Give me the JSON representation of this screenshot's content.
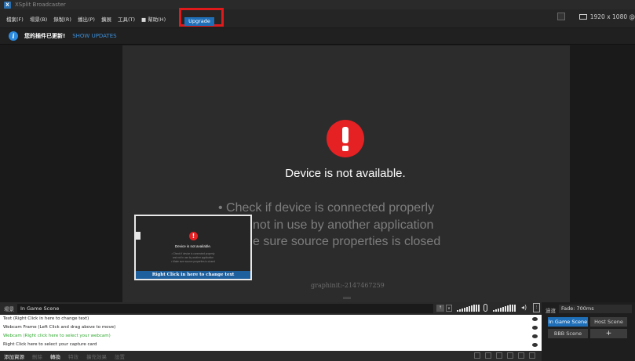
{
  "window": {
    "title": "XSplit Broadcaster",
    "icon": "xsplit-logo-icon"
  },
  "menu": {
    "items": [
      "檔案(F)",
      "場景(B)",
      "錄製(R)",
      "播出(P)",
      "擴展",
      "工具(T)",
      "■ 幫助(H)"
    ],
    "upgrade_label": "Upgrade",
    "resolution": "1920 x 1080 @"
  },
  "notice": {
    "text": "您的插件已更新!",
    "link": "SHOW UPDATES"
  },
  "stage": {
    "title": "Device is not available.",
    "hints": [
      "• Check if device is connected properly",
      "not in use by another application",
      "e sure source properties is closed"
    ],
    "footer": "graphinit:-2147467259"
  },
  "thumbnail": {
    "title": "Device is not available.",
    "hints": [
      "• Check if device is connected properly",
      "and not in use by another application",
      "• Make sure source properties is closed"
    ],
    "bar_label": "Right Click in here to change text"
  },
  "scene": {
    "label": "場景",
    "name": "In Game Scene"
  },
  "audio": {
    "volume_box": "↑",
    "dropdown": "∨"
  },
  "transition": {
    "label": "過渡",
    "fade": "Fade: 700ms",
    "buttons": {
      "game": "In Game Scene",
      "host": "Host Scene",
      "bbb": "BBB Scene",
      "add": "+"
    }
  },
  "sources": [
    {
      "text": "Text (Right Click in here to change text)",
      "style": "normal"
    },
    {
      "text": "Webcam Frame (Left Click and drag above to move)",
      "style": "normal"
    },
    {
      "text": "Webcam (Right click here to select your webcam)",
      "style": "green"
    },
    {
      "text": "Right Click here to select your capture card",
      "style": "normal"
    }
  ],
  "toolbar": {
    "items": [
      "添加資源",
      "刪除",
      "轉換",
      "特效",
      "擴充效果",
      "設置"
    ]
  },
  "colors": {
    "accent": "#1f6fb8",
    "alert": "#e52124",
    "highlight_box": "#e0191b",
    "green_source": "#2fa82f"
  }
}
